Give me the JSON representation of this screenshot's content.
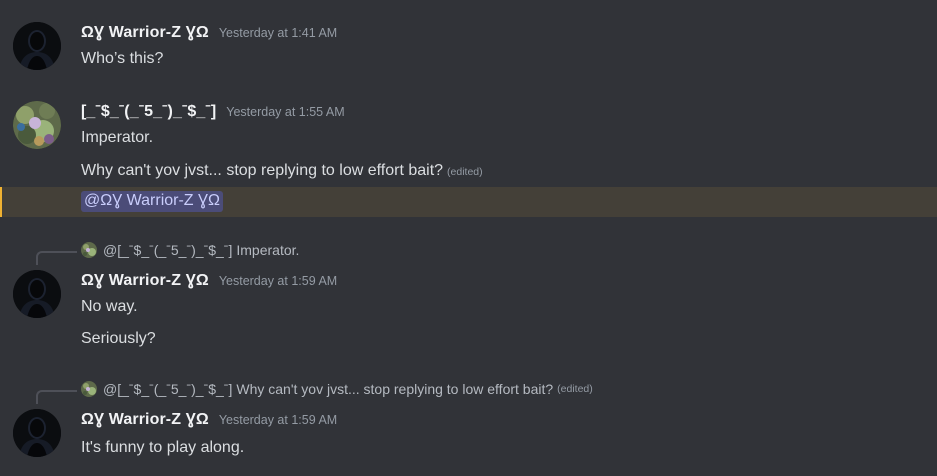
{
  "messages": [
    {
      "author": "ΩƔ Warrior-Z ƔΩ",
      "timestamp": "Yesterday at 1:41 AM",
      "lines": [
        "Who’s this?"
      ]
    },
    {
      "author": "[_ˉ$_ˉ(_ˉ5_ˉ)_ˉ$_ˉ]",
      "timestamp": "Yesterday at 1:55 AM",
      "lines": [
        "Imperator.",
        "Why can't yov jvst... stop replying to low effort bait?"
      ],
      "edited_label": "(edited)",
      "mention": "@ΩƔ Warrior-Z ƔΩ"
    },
    {
      "reply": {
        "author": "@[_ˉ$_ˉ(_ˉ5_ˉ)_ˉ$_ˉ]",
        "text": "Imperator."
      },
      "author": "ΩƔ Warrior-Z ƔΩ",
      "timestamp": "Yesterday at 1:59 AM",
      "lines": [
        "No way.",
        "Seriously?"
      ]
    },
    {
      "reply": {
        "author": "@[_ˉ$_ˉ(_ˉ5_ˉ)_ˉ$_ˉ]",
        "text": "Why can't yov jvst... stop replying to low effort bait?",
        "edited_label": "(edited)"
      },
      "author": "ΩƔ Warrior-Z ƔΩ",
      "timestamp": "Yesterday at 1:59 AM",
      "lines": [
        "It's funny to play along."
      ]
    }
  ],
  "colors": {
    "background": "#313338",
    "mention_highlight": "#444038",
    "mention_pill": "#5865f2",
    "username": "#f2f3f5",
    "timestamp": "#949ba4"
  }
}
